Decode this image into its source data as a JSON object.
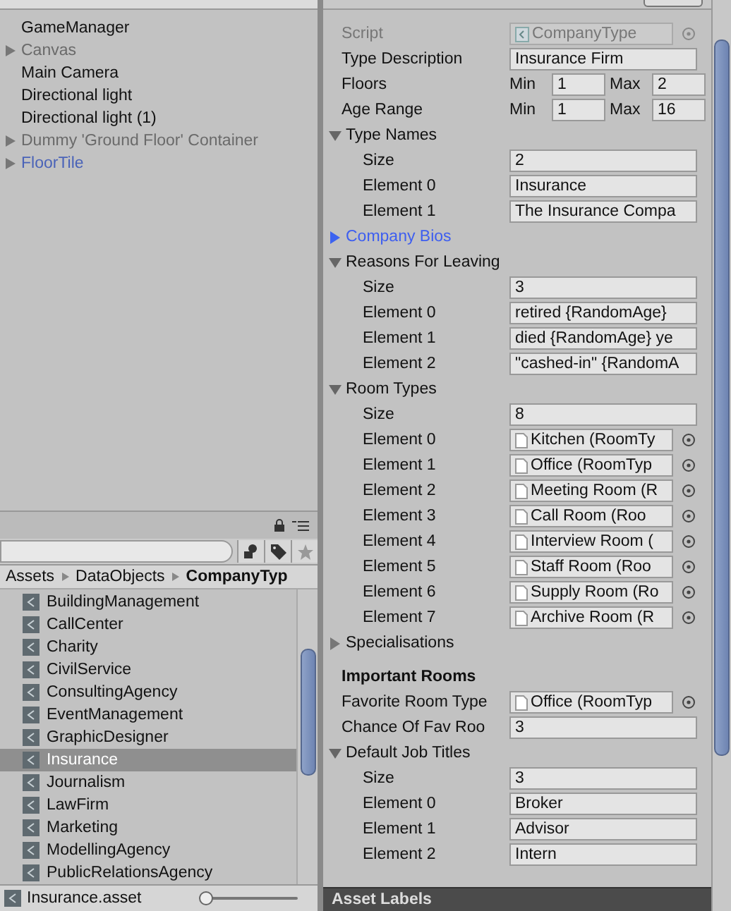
{
  "hierarchy": {
    "items": [
      {
        "label": "GameManager",
        "has_children": false,
        "kind": "normal"
      },
      {
        "label": "Canvas",
        "has_children": true,
        "kind": "inactive"
      },
      {
        "label": "Main Camera",
        "has_children": false,
        "kind": "normal"
      },
      {
        "label": "Directional light",
        "has_children": false,
        "kind": "normal"
      },
      {
        "label": "Directional light (1)",
        "has_children": false,
        "kind": "normal"
      },
      {
        "label": "Dummy 'Ground Floor' Container",
        "has_children": true,
        "kind": "inactive"
      },
      {
        "label": "FloorTile",
        "has_children": true,
        "kind": "prefab"
      }
    ]
  },
  "project": {
    "breadcrumb": [
      "Assets",
      "DataObjects",
      "CompanyTyp"
    ],
    "items": [
      {
        "label": "BuildingManagement",
        "selected": false
      },
      {
        "label": "CallCenter",
        "selected": false
      },
      {
        "label": "Charity",
        "selected": false
      },
      {
        "label": "CivilService",
        "selected": false
      },
      {
        "label": "ConsultingAgency",
        "selected": false
      },
      {
        "label": "EventManagement",
        "selected": false
      },
      {
        "label": "GraphicDesigner",
        "selected": false
      },
      {
        "label": "Insurance",
        "selected": true
      },
      {
        "label": "Journalism",
        "selected": false
      },
      {
        "label": "LawFirm",
        "selected": false
      },
      {
        "label": "Marketing",
        "selected": false
      },
      {
        "label": "ModellingAgency",
        "selected": false
      },
      {
        "label": "PublicRelationsAgency",
        "selected": false
      }
    ],
    "footer": {
      "file": "Insurance.asset",
      "zoom": {
        "level": 0
      }
    }
  },
  "inspector": {
    "rows": [
      {
        "kind": "script",
        "label": "Script",
        "value": "CompanyType"
      },
      {
        "kind": "text",
        "label": "Type Description",
        "value": "Insurance Firm"
      },
      {
        "kind": "range",
        "label": "Floors",
        "min_label": "Min",
        "min": "1",
        "max_label": "Max",
        "max": "2"
      },
      {
        "kind": "range",
        "label": "Age Range",
        "min_label": "Min",
        "min": "1",
        "max_label": "Max",
        "max": "16"
      },
      {
        "kind": "foldout",
        "label": "Type Names",
        "expanded": true,
        "highlighted": false,
        "children": [
          {
            "kind": "text",
            "label": "Size",
            "value": "2"
          },
          {
            "kind": "text",
            "label": "Element 0",
            "value": "Insurance"
          },
          {
            "kind": "text",
            "label": "Element 1",
            "value": "The Insurance Compa"
          }
        ]
      },
      {
        "kind": "foldout",
        "label": "Company Bios",
        "expanded": false,
        "highlighted": true
      },
      {
        "kind": "foldout",
        "label": "Reasons For Leaving",
        "expanded": true,
        "highlighted": false,
        "children": [
          {
            "kind": "text",
            "label": "Size",
            "value": "3"
          },
          {
            "kind": "text",
            "label": "Element 0",
            "value": "retired {RandomAge}"
          },
          {
            "kind": "text",
            "label": "Element 1",
            "value": "died {RandomAge} ye"
          },
          {
            "kind": "text",
            "label": "Element 2",
            "value": "\"cashed-in\" {RandomA"
          }
        ]
      },
      {
        "kind": "foldout",
        "label": "Room Types",
        "expanded": true,
        "highlighted": false,
        "children": [
          {
            "kind": "text",
            "label": "Size",
            "value": "8"
          },
          {
            "kind": "object",
            "label": "Element 0",
            "value": "Kitchen (RoomTy"
          },
          {
            "kind": "object",
            "label": "Element 1",
            "value": "Office (RoomTyp"
          },
          {
            "kind": "object",
            "label": "Element 2",
            "value": "Meeting Room (R"
          },
          {
            "kind": "object",
            "label": "Element 3",
            "value": "Call Room (Roo"
          },
          {
            "kind": "object",
            "label": "Element 4",
            "value": "Interview Room ("
          },
          {
            "kind": "object",
            "label": "Element 5",
            "value": "Staff Room (Roo"
          },
          {
            "kind": "object",
            "label": "Element 6",
            "value": "Supply Room (Ro"
          },
          {
            "kind": "object",
            "label": "Element 7",
            "value": "Archive Room (R"
          }
        ]
      },
      {
        "kind": "foldout",
        "label": "Specialisations",
        "expanded": false,
        "highlighted": false
      },
      {
        "kind": "header",
        "label": "Important Rooms"
      },
      {
        "kind": "object",
        "label": "Favorite Room Type",
        "value": "Office (RoomTyp"
      },
      {
        "kind": "text",
        "label": "Chance Of Fav Roo",
        "value": "3"
      },
      {
        "kind": "foldout",
        "label": "Default Job Titles",
        "expanded": true,
        "highlighted": false,
        "children": [
          {
            "kind": "text",
            "label": "Size",
            "value": "3"
          },
          {
            "kind": "text",
            "label": "Element 0",
            "value": "Broker"
          },
          {
            "kind": "text",
            "label": "Element 1",
            "value": "Advisor"
          },
          {
            "kind": "text",
            "label": "Element 2",
            "value": "Intern"
          }
        ]
      }
    ],
    "footer": "Asset Labels"
  }
}
